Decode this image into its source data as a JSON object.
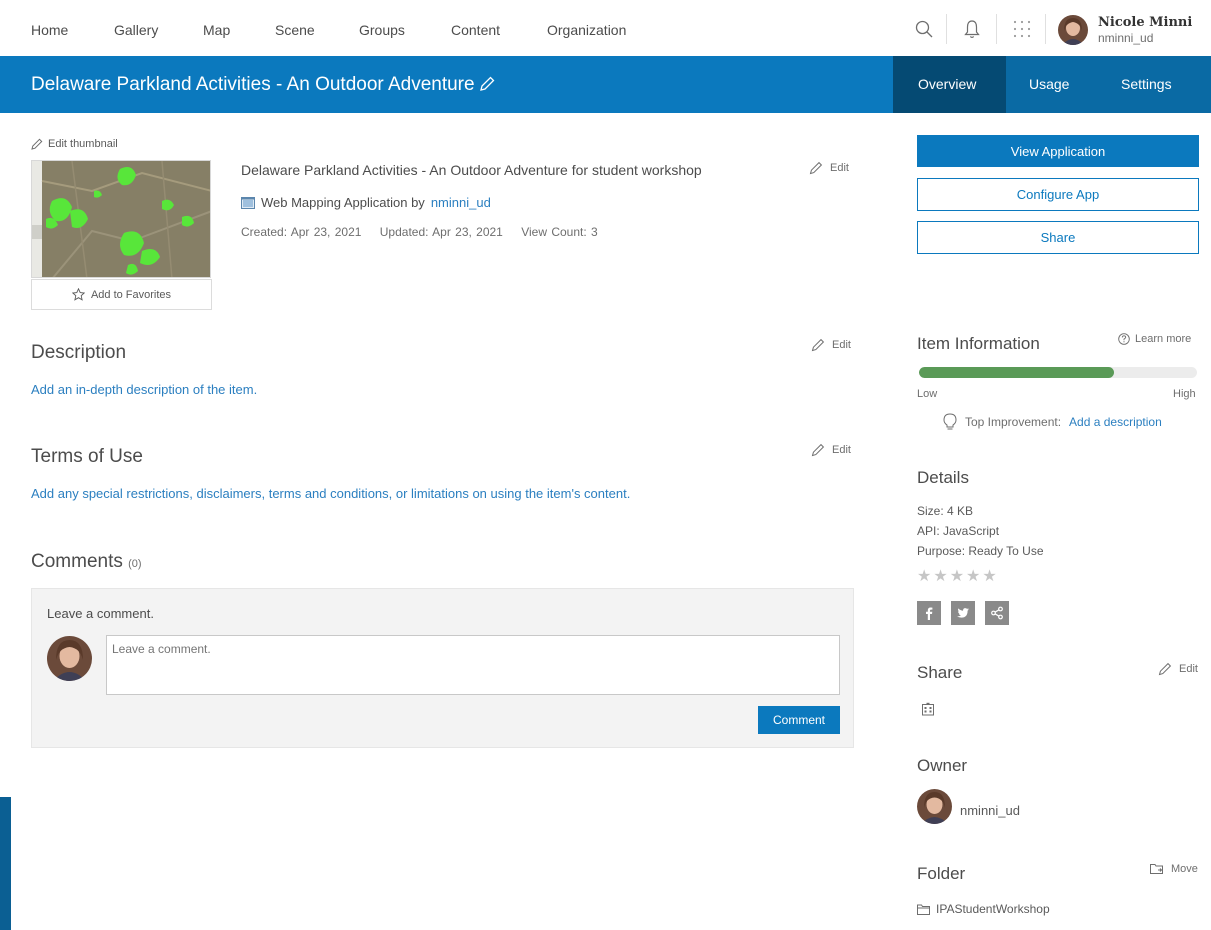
{
  "nav": {
    "items": [
      "Home",
      "Gallery",
      "Map",
      "Scene",
      "Groups",
      "Content",
      "Organization"
    ],
    "user": {
      "name": "Nicole Minni",
      "handle": "nminni_ud"
    }
  },
  "titlebar": {
    "title": "Delaware Parkland Activities - An Outdoor Adventure",
    "tabs": [
      "Overview",
      "Usage",
      "Settings"
    ],
    "active_tab": "Overview"
  },
  "item": {
    "edit_thumbnail": "Edit thumbnail",
    "add_to_favorites": "Add to Favorites",
    "summary": "Delaware Parkland Activities - An Outdoor Adventure for student workshop",
    "type_prefix": "Web Mapping Application by",
    "owner_link": "nminni_ud",
    "created": "Created: Apr 23, 2021",
    "updated": "Updated: Apr 23, 2021",
    "view_count": "View Count: 3",
    "edit": "Edit"
  },
  "description": {
    "heading": "Description",
    "add_link": "Add an in-depth description of the item."
  },
  "terms": {
    "heading": "Terms of Use",
    "add_link": "Add any special restrictions, disclaimers, terms and conditions, or limitations on using the item's content."
  },
  "comments": {
    "heading": "Comments",
    "count": "(0)",
    "label": "Leave a comment.",
    "placeholder": "Leave a comment.",
    "button": "Comment"
  },
  "actions": {
    "view_application": "View Application",
    "configure_app": "Configure App",
    "share": "Share"
  },
  "item_information": {
    "heading": "Item Information",
    "learn_more": "Learn more",
    "progress": 0.7,
    "low": "Low",
    "high": "High",
    "top_improvement_label": "Top Improvement:",
    "top_improvement_link": "Add a description"
  },
  "details": {
    "heading": "Details",
    "size": "Size: 4 KB",
    "api": "API: JavaScript",
    "purpose": "Purpose: Ready To Use",
    "stars": 0
  },
  "share_section": {
    "heading": "Share",
    "edit": "Edit"
  },
  "owner": {
    "heading": "Owner",
    "name": "nminni_ud"
  },
  "folder": {
    "heading": "Folder",
    "move": "Move",
    "name": "IPAStudentWorkshop"
  },
  "colors": {
    "brand_blue": "#0b79be",
    "active_tab": "#054a73",
    "progress_green": "#5a9a57",
    "link": "#2b7fc0"
  }
}
